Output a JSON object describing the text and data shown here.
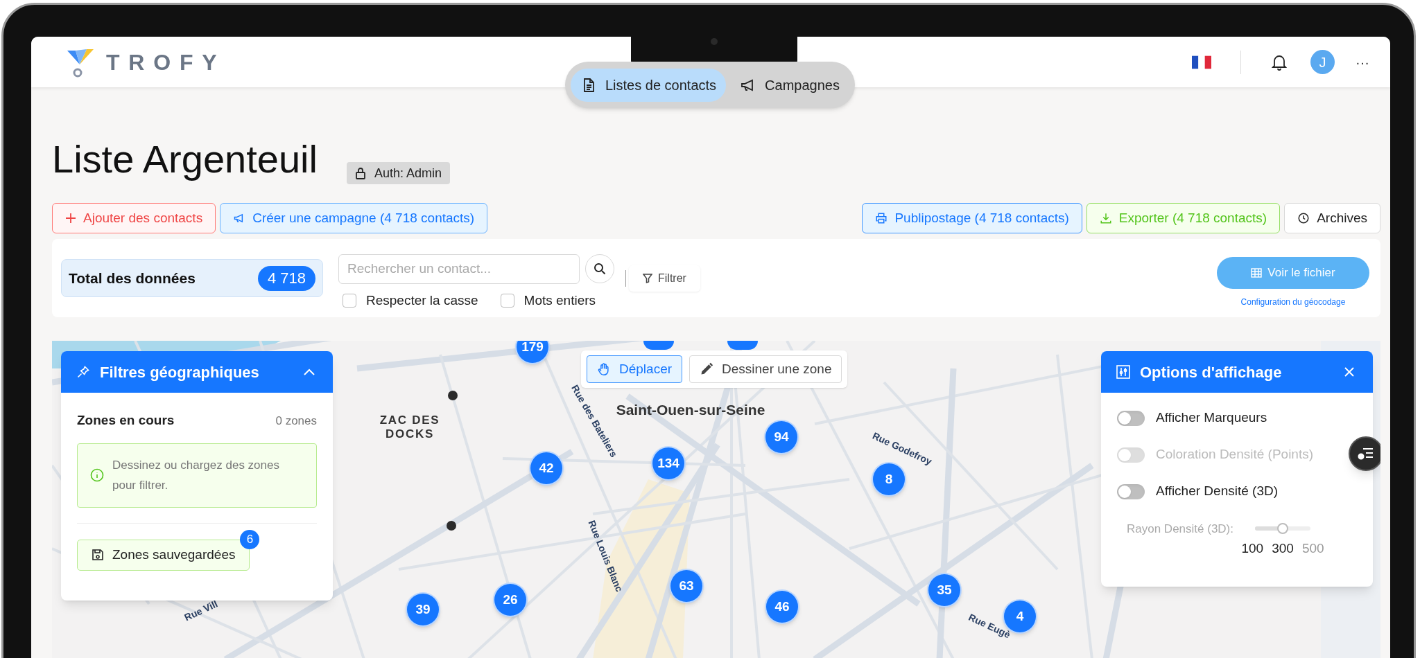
{
  "header": {
    "logo": "TROFY",
    "nav": [
      {
        "label": "Listes de contacts",
        "selected": true,
        "kind": "list"
      },
      {
        "label": "Campagnes",
        "selected": false,
        "kind": "campaign"
      }
    ],
    "avatar": "J",
    "more": "···"
  },
  "page": {
    "title": "Liste Argenteuil",
    "auth_badge": "Auth: Admin"
  },
  "actions": [
    {
      "label": "Ajouter des contacts",
      "kind": "add"
    },
    {
      "label": "Créer une campagne (4 718 contacts)",
      "kind": "campaign"
    },
    {
      "label": "Publipostage (4 718 contacts)",
      "kind": "print"
    },
    {
      "label": "Exporter (4 718 contacts)",
      "kind": "export"
    },
    {
      "label": "Archives",
      "kind": "archive"
    }
  ],
  "toolbar": {
    "total_label": "Total des données",
    "total_count": "4 718",
    "search": {
      "placeholder": "Rechercher un contact..."
    },
    "options": [
      {
        "label": "Respecter la casse",
        "checked": false
      },
      {
        "label": "Mots entiers",
        "checked": false
      }
    ],
    "filter": "Filtrer",
    "view_file": "Voir le fichier",
    "geocoding_link": "Configuration du géocodage"
  },
  "map": {
    "tools": [
      {
        "label": "Déplacer",
        "selected": true,
        "kind": "pan"
      },
      {
        "label": "Dessiner une zone",
        "selected": false,
        "kind": "draw"
      }
    ],
    "labels": [
      {
        "text": "ZAC DES DOCKS",
        "kind": "district"
      },
      {
        "text": "Saint-Ouen-sur-Seine",
        "kind": "city"
      },
      {
        "text": "Rue des Bateliers",
        "kind": "street"
      },
      {
        "text": "Rue Louis Blanc",
        "kind": "street"
      },
      {
        "text": "Rue Godefroy",
        "kind": "street"
      },
      {
        "text": "Rue Eugè",
        "kind": "street"
      },
      {
        "text": "Rue Vill",
        "kind": "street"
      }
    ],
    "clusters": [
      "179",
      "94",
      "42",
      "134",
      "8",
      "63",
      "26",
      "39",
      "46",
      "35",
      "4"
    ]
  },
  "geo_panel": {
    "title": "Filtres géographiques",
    "expanded": true,
    "section": "Zones en cours",
    "zone_count": "0 zones",
    "info": "Dessinez ou chargez des zones pour filtrer.",
    "saved_button": "Zones sauvegardées",
    "saved_badge": "6"
  },
  "display_panel": {
    "title": "Options d'affichage",
    "toggles": [
      {
        "label": "Afficher Marqueurs",
        "on": false,
        "disabled": false
      },
      {
        "label": "Coloration Densité (Points)",
        "on": false,
        "disabled": true
      },
      {
        "label": "Afficher Densité (3D)",
        "on": false,
        "disabled": false
      }
    ],
    "radius": {
      "label": "Rayon Densité (3D):",
      "level": 0.5,
      "ticks": [
        "100",
        "300",
        "500"
      ]
    }
  }
}
